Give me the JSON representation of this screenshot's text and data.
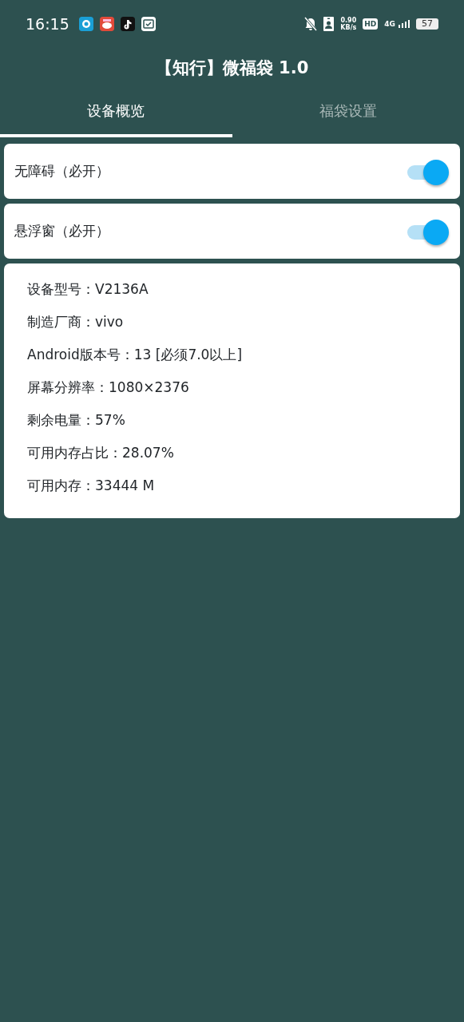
{
  "status_bar": {
    "time": "16:15",
    "net_speed": "0.90",
    "net_unit": "KB/s",
    "hd": "HD",
    "network": "4G",
    "battery": "57"
  },
  "title": "【知行】微福袋 1.0",
  "tabs": [
    {
      "label": "设备概览",
      "selected": true
    },
    {
      "label": "福袋设置",
      "selected": false
    }
  ],
  "switches": [
    {
      "label": "无障碍（必开）",
      "on": true
    },
    {
      "label": "悬浮窗（必开）",
      "on": true
    }
  ],
  "device_info": [
    "设备型号：V2136A",
    "制造厂商：vivo",
    "Android版本号：13 [必须7.0以上]",
    "屏幕分辨率：1080×2376",
    "剩余电量：57%",
    "可用内存占比：28.07%",
    "可用内存：33444 M"
  ]
}
